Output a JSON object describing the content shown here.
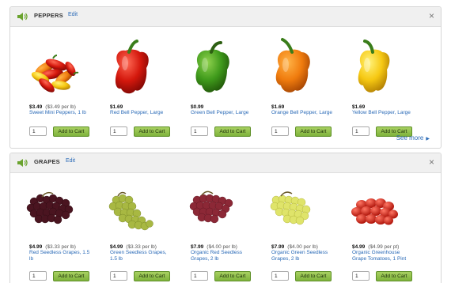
{
  "colors": {
    "link": "#2a6ab7",
    "button": "#8dc045",
    "header_bg": "#f0f0f0"
  },
  "sections": [
    {
      "title": "PEPPERS",
      "edit_label": "Edit",
      "close_icon": "×",
      "items": [
        {
          "price": "$3.49",
          "unit_price": "($3.49 per lb)",
          "name": "Sweet Mini Peppers, 1 lb",
          "qty": "1",
          "button": "Add to Cart",
          "image": "mini-peppers"
        },
        {
          "price": "$1.69",
          "unit_price": "",
          "name": "Red Bell Pepper, Large",
          "qty": "1",
          "button": "Add to Cart",
          "image": "red-bell-pepper"
        },
        {
          "price": "$0.99",
          "unit_price": "",
          "name": "Green Bell Pepper, Large",
          "qty": "1",
          "button": "Add to Cart",
          "image": "green-bell-pepper"
        },
        {
          "price": "$1.69",
          "unit_price": "",
          "name": "Orange Bell Pepper, Large",
          "qty": "1",
          "button": "Add to Cart",
          "image": "orange-bell-pepper"
        },
        {
          "price": "$1.69",
          "unit_price": "",
          "name": "Yellow Bell Pepper, Large",
          "qty": "1",
          "button": "Add to Cart",
          "image": "yellow-bell-pepper"
        }
      ],
      "see_more": "See more"
    },
    {
      "title": "GRAPES",
      "edit_label": "Edit",
      "close_icon": "×",
      "items": [
        {
          "price": "$4.99",
          "unit_price": "($3.33 per lb)",
          "name": "Red Seedless Grapes, 1.5 lb",
          "qty": "1",
          "button": "Add to Cart",
          "image": "red-grapes"
        },
        {
          "price": "$4.99",
          "unit_price": "($3.33 per lb)",
          "name": "Green Seedless Grapes, 1.5 lb",
          "qty": "1",
          "button": "Add to Cart",
          "image": "green-grapes"
        },
        {
          "price": "$7.99",
          "unit_price": "($4.00 per lb)",
          "name": "Organic Red Seedless Grapes, 2 lb",
          "qty": "1",
          "button": "Add to Cart",
          "image": "organic-red-grapes"
        },
        {
          "price": "$7.99",
          "unit_price": "($4.00 per lb)",
          "name": "Organic Green Seedless Grapes, 2 lb",
          "qty": "1",
          "button": "Add to Cart",
          "image": "organic-green-grapes"
        },
        {
          "price": "$4.99",
          "unit_price": "($4.99 per pt)",
          "name": "Organic Greenhouse Grape Tomatoes, 1 Pint",
          "qty": "1",
          "button": "Add to Cart",
          "image": "grape-tomatoes"
        }
      ]
    }
  ]
}
